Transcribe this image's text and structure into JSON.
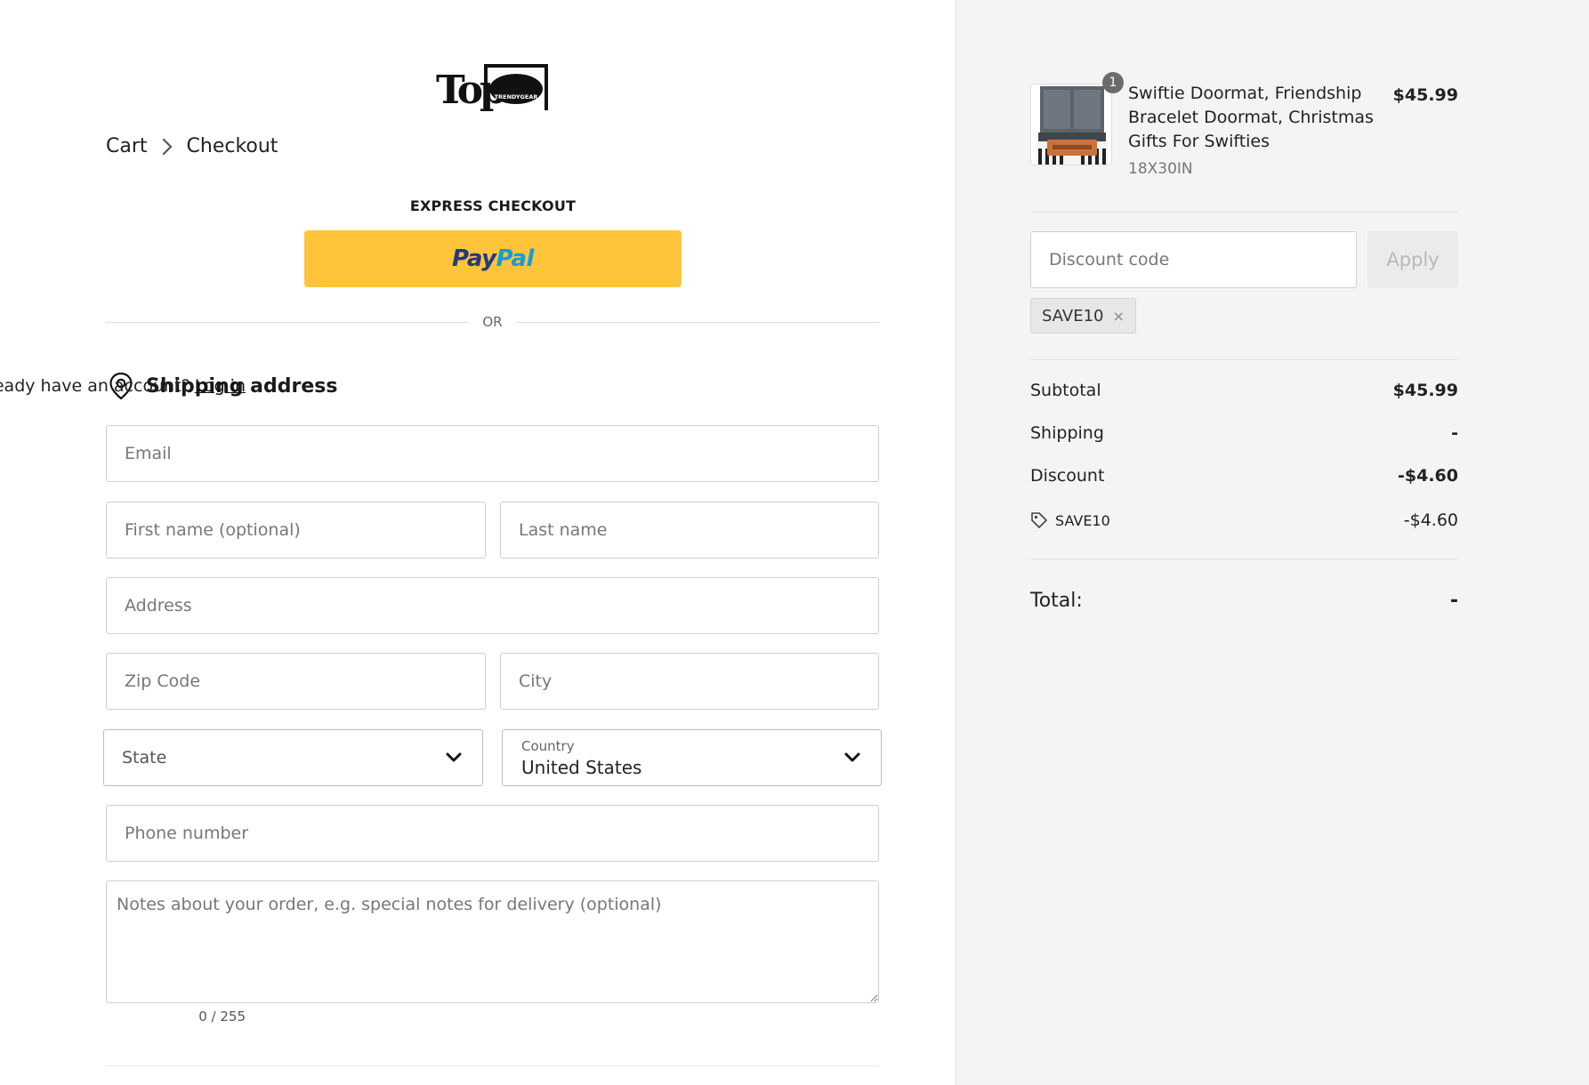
{
  "breadcrumb": {
    "cart": "Cart",
    "checkout": "Checkout"
  },
  "logo": {
    "text": "TopTT",
    "subtext": "TRENDYGEAR"
  },
  "express": {
    "label": "EXPRESS CHECKOUT",
    "paypal_pay": "Pay",
    "paypal_pal": "Pal"
  },
  "or_text": "OR",
  "shipping": {
    "title": "Shipping address",
    "account_prompt": "Already have an account?",
    "login_link": "Log in"
  },
  "form": {
    "email_placeholder": "Email",
    "first_name_placeholder": "First name (optional)",
    "last_name_placeholder": "Last name",
    "address_placeholder": "Address",
    "zip_placeholder": "Zip Code",
    "city_placeholder": "City",
    "state_placeholder": "State",
    "country_label": "Country",
    "country_value": "United States",
    "phone_placeholder": "Phone number",
    "notes_placeholder": "Notes about your order, e.g. special notes for delivery (optional)",
    "char_count": "0 / 255"
  },
  "cart": {
    "quantity": "1",
    "product_name": "Swiftie Doormat, Friendship Bracelet Doormat, Christmas Gifts For Swifties",
    "variant": "18X30IN",
    "price": "$45.99"
  },
  "discount": {
    "placeholder": "Discount code",
    "apply_label": "Apply",
    "applied_code": "SAVE10",
    "remove_symbol": "×"
  },
  "summary": {
    "subtotal_label": "Subtotal",
    "subtotal_value": "$45.99",
    "shipping_label": "Shipping",
    "shipping_value": "-",
    "discount_label": "Discount",
    "discount_value": "-$4.60",
    "code_label": "SAVE10",
    "code_value": "-$4.60",
    "total_label": "Total:",
    "total_value": "-"
  },
  "colors": {
    "paypal_button": "#ffc43a",
    "paypal_dark": "#253b80",
    "paypal_light": "#179bd7",
    "sidebar_bg": "#f4f4f4"
  }
}
